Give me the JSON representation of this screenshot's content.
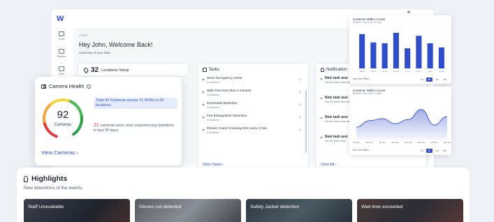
{
  "app": {
    "logo": "W"
  },
  "sidebar": {
    "items": [
      {
        "label": "Home",
        "icon": "home-icon"
      },
      {
        "label": "Reports",
        "icon": "video-icon"
      },
      {
        "label": "Task",
        "icon": "task-icon"
      }
    ]
  },
  "header": {
    "breadcrumb": "Home",
    "welcome": "Hey John, Welcome Back!",
    "summary": "Summary of your data"
  },
  "locations": {
    "count": "32",
    "label": "Locations Setup"
  },
  "tasks": {
    "title": "Tasks",
    "items": [
      {
        "title": "Store Occupancy Alerts",
        "sub": "3 locations"
      },
      {
        "title": "Wait Time less than x minutes",
        "sub": "3 locations"
      },
      {
        "title": "Facemask Detection",
        "sub": "3 locations"
      },
      {
        "title": "Fire Extinguisher Detection",
        "sub": "3 locations"
      },
      {
        "title": "Person Count Crossing ROI every X Sec",
        "sub": "3 locations"
      }
    ],
    "view_all": "View Tasks ›"
  },
  "notifications": {
    "title": "Notification",
    "items": [
      {
        "title": "New task assi",
        "body": "You've been assi task for New Yo"
      },
      {
        "title": "New task assi",
        "body": "You've been assi task for San Jos"
      },
      {
        "title": "New task assi",
        "body": "You've been assi task for San Fra"
      },
      {
        "title": "New task assi",
        "body": "You've been assi"
      }
    ],
    "view_all": "View All ›"
  },
  "charts": {
    "filter_label": "New York Office ⌄",
    "tabs": [
      "1h",
      "5d",
      "1m",
      "6m"
    ],
    "active_tab": "5d"
  },
  "chart_data": [
    {
      "type": "bar",
      "title": "Customer Walk in Count",
      "subtitle": "Between Time (Last 12 Days)",
      "categories": [
        "8 am",
        "9 am",
        "10 am",
        "11 am",
        "1 pm",
        "2 pm",
        "3 pm",
        "4 pm"
      ],
      "values": [
        82,
        62,
        60,
        85,
        48,
        78,
        60,
        50
      ],
      "ylim": [
        0,
        100
      ],
      "color": "#2f4ec8"
    },
    {
      "type": "area",
      "title": "Customer Walk in Count",
      "subtitle": "Between Time (Last 12 Days)",
      "categories": [
        "7th Dec",
        "8th Dec",
        "9th Dec",
        "10th Dec",
        "11th Dec",
        "12th Dec",
        "13th Dec",
        "14th Dec"
      ],
      "values": [
        30,
        45,
        50,
        38,
        48,
        72,
        35,
        55
      ],
      "ylim": [
        0,
        100
      ],
      "color": "#2f4ec8"
    }
  ],
  "camera_health": {
    "title": "Camera Health",
    "count": "92",
    "count_label": "Cameras",
    "highlight": "Total 92 Cameras across 11 NVRs in 32 locations",
    "warn_count": "21",
    "warn_text": " cameras were seen experiencing downtime in last 30 days.",
    "view_link": "View Cameras ›",
    "gauge_colors": [
      "#e23a3a",
      "#f2a33c",
      "#f4d63a",
      "#4cb858",
      "#2f9f4a"
    ]
  },
  "highlights": {
    "title": "Highlights",
    "subtitle": "New detections of the events.",
    "items": [
      {
        "label": "Staff Unavailable"
      },
      {
        "label": "Gloves not detected"
      },
      {
        "label": "Safety Jacket detection"
      },
      {
        "label": "Wait time exceeded"
      }
    ]
  }
}
